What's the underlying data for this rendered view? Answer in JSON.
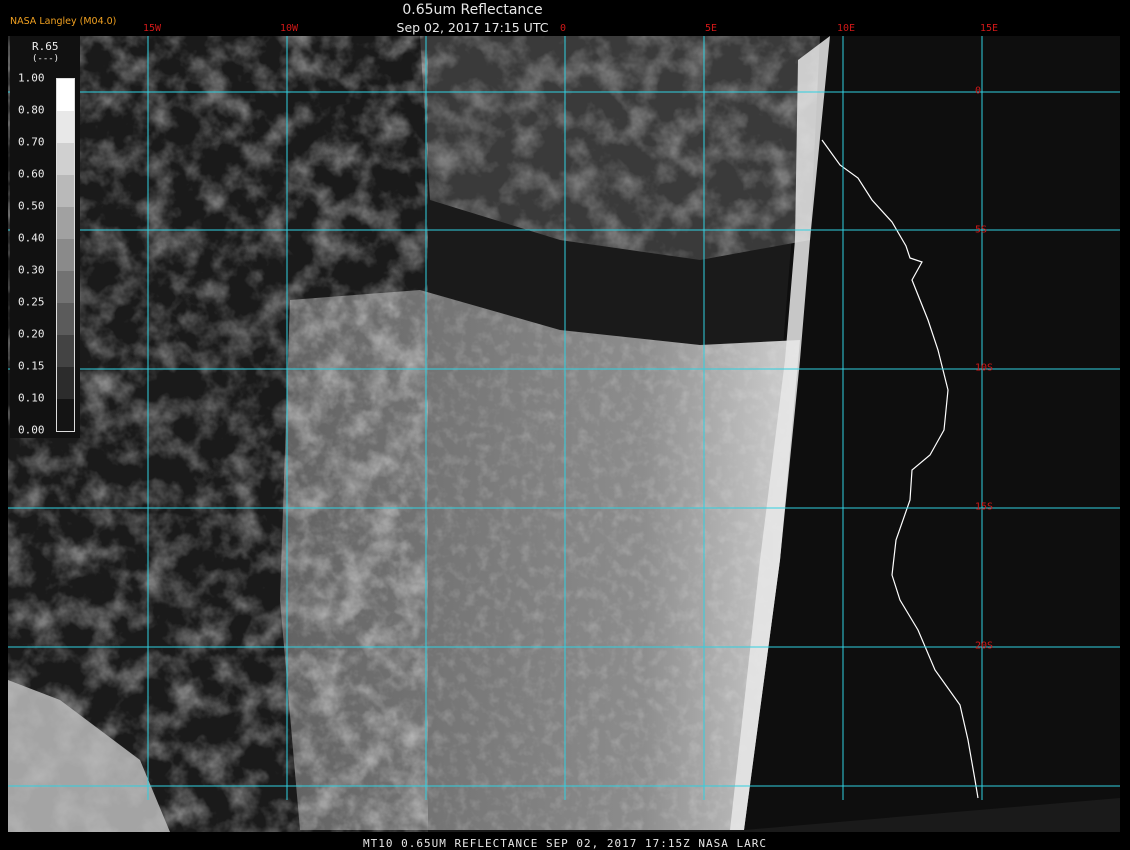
{
  "header": {
    "title": "0.65um Reflectance",
    "datetime": "Sep 02, 2017 17:15 UTC",
    "credit": "NASA Langley (M04.0)"
  },
  "grid": {
    "longitude_labels": [
      "15W",
      "10W",
      "0",
      "5E",
      "10E",
      "15E"
    ],
    "latitude_labels": [
      "0",
      "5S",
      "10S",
      "15S",
      "20S"
    ],
    "line_color": "#30d0e0",
    "label_color": "#d01818"
  },
  "legend": {
    "heading": "R.65",
    "unit": "(---)",
    "ticks": [
      "1.00",
      "0.80",
      "0.70",
      "0.60",
      "0.50",
      "0.40",
      "0.30",
      "0.25",
      "0.20",
      "0.15",
      "0.10",
      "0.00"
    ]
  },
  "coastline": {
    "color": "#ffffff"
  },
  "footer": "MT10  0.65UM REFLECTANCE   SEP 02, 2017 17:15Z   NASA LARC"
}
